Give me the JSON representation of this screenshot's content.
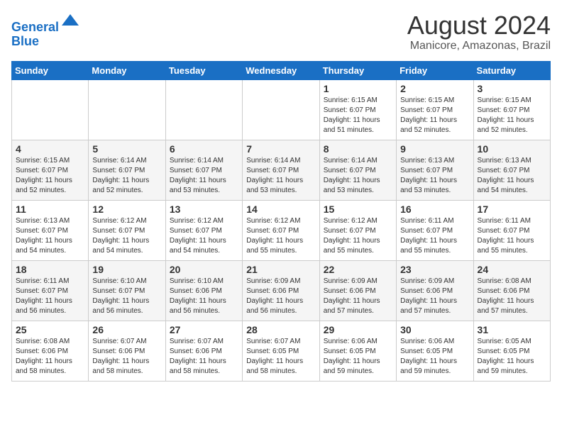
{
  "header": {
    "logo_line1": "General",
    "logo_line2": "Blue",
    "month": "August 2024",
    "location": "Manicore, Amazonas, Brazil"
  },
  "weekdays": [
    "Sunday",
    "Monday",
    "Tuesday",
    "Wednesday",
    "Thursday",
    "Friday",
    "Saturday"
  ],
  "weeks": [
    [
      {
        "day": "",
        "info": ""
      },
      {
        "day": "",
        "info": ""
      },
      {
        "day": "",
        "info": ""
      },
      {
        "day": "",
        "info": ""
      },
      {
        "day": "1",
        "info": "Sunrise: 6:15 AM\nSunset: 6:07 PM\nDaylight: 11 hours\nand 51 minutes."
      },
      {
        "day": "2",
        "info": "Sunrise: 6:15 AM\nSunset: 6:07 PM\nDaylight: 11 hours\nand 52 minutes."
      },
      {
        "day": "3",
        "info": "Sunrise: 6:15 AM\nSunset: 6:07 PM\nDaylight: 11 hours\nand 52 minutes."
      }
    ],
    [
      {
        "day": "4",
        "info": "Sunrise: 6:15 AM\nSunset: 6:07 PM\nDaylight: 11 hours\nand 52 minutes."
      },
      {
        "day": "5",
        "info": "Sunrise: 6:14 AM\nSunset: 6:07 PM\nDaylight: 11 hours\nand 52 minutes."
      },
      {
        "day": "6",
        "info": "Sunrise: 6:14 AM\nSunset: 6:07 PM\nDaylight: 11 hours\nand 53 minutes."
      },
      {
        "day": "7",
        "info": "Sunrise: 6:14 AM\nSunset: 6:07 PM\nDaylight: 11 hours\nand 53 minutes."
      },
      {
        "day": "8",
        "info": "Sunrise: 6:14 AM\nSunset: 6:07 PM\nDaylight: 11 hours\nand 53 minutes."
      },
      {
        "day": "9",
        "info": "Sunrise: 6:13 AM\nSunset: 6:07 PM\nDaylight: 11 hours\nand 53 minutes."
      },
      {
        "day": "10",
        "info": "Sunrise: 6:13 AM\nSunset: 6:07 PM\nDaylight: 11 hours\nand 54 minutes."
      }
    ],
    [
      {
        "day": "11",
        "info": "Sunrise: 6:13 AM\nSunset: 6:07 PM\nDaylight: 11 hours\nand 54 minutes."
      },
      {
        "day": "12",
        "info": "Sunrise: 6:12 AM\nSunset: 6:07 PM\nDaylight: 11 hours\nand 54 minutes."
      },
      {
        "day": "13",
        "info": "Sunrise: 6:12 AM\nSunset: 6:07 PM\nDaylight: 11 hours\nand 54 minutes."
      },
      {
        "day": "14",
        "info": "Sunrise: 6:12 AM\nSunset: 6:07 PM\nDaylight: 11 hours\nand 55 minutes."
      },
      {
        "day": "15",
        "info": "Sunrise: 6:12 AM\nSunset: 6:07 PM\nDaylight: 11 hours\nand 55 minutes."
      },
      {
        "day": "16",
        "info": "Sunrise: 6:11 AM\nSunset: 6:07 PM\nDaylight: 11 hours\nand 55 minutes."
      },
      {
        "day": "17",
        "info": "Sunrise: 6:11 AM\nSunset: 6:07 PM\nDaylight: 11 hours\nand 55 minutes."
      }
    ],
    [
      {
        "day": "18",
        "info": "Sunrise: 6:11 AM\nSunset: 6:07 PM\nDaylight: 11 hours\nand 56 minutes."
      },
      {
        "day": "19",
        "info": "Sunrise: 6:10 AM\nSunset: 6:07 PM\nDaylight: 11 hours\nand 56 minutes."
      },
      {
        "day": "20",
        "info": "Sunrise: 6:10 AM\nSunset: 6:06 PM\nDaylight: 11 hours\nand 56 minutes."
      },
      {
        "day": "21",
        "info": "Sunrise: 6:09 AM\nSunset: 6:06 PM\nDaylight: 11 hours\nand 56 minutes."
      },
      {
        "day": "22",
        "info": "Sunrise: 6:09 AM\nSunset: 6:06 PM\nDaylight: 11 hours\nand 57 minutes."
      },
      {
        "day": "23",
        "info": "Sunrise: 6:09 AM\nSunset: 6:06 PM\nDaylight: 11 hours\nand 57 minutes."
      },
      {
        "day": "24",
        "info": "Sunrise: 6:08 AM\nSunset: 6:06 PM\nDaylight: 11 hours\nand 57 minutes."
      }
    ],
    [
      {
        "day": "25",
        "info": "Sunrise: 6:08 AM\nSunset: 6:06 PM\nDaylight: 11 hours\nand 58 minutes."
      },
      {
        "day": "26",
        "info": "Sunrise: 6:07 AM\nSunset: 6:06 PM\nDaylight: 11 hours\nand 58 minutes."
      },
      {
        "day": "27",
        "info": "Sunrise: 6:07 AM\nSunset: 6:06 PM\nDaylight: 11 hours\nand 58 minutes."
      },
      {
        "day": "28",
        "info": "Sunrise: 6:07 AM\nSunset: 6:05 PM\nDaylight: 11 hours\nand 58 minutes."
      },
      {
        "day": "29",
        "info": "Sunrise: 6:06 AM\nSunset: 6:05 PM\nDaylight: 11 hours\nand 59 minutes."
      },
      {
        "day": "30",
        "info": "Sunrise: 6:06 AM\nSunset: 6:05 PM\nDaylight: 11 hours\nand 59 minutes."
      },
      {
        "day": "31",
        "info": "Sunrise: 6:05 AM\nSunset: 6:05 PM\nDaylight: 11 hours\nand 59 minutes."
      }
    ]
  ]
}
